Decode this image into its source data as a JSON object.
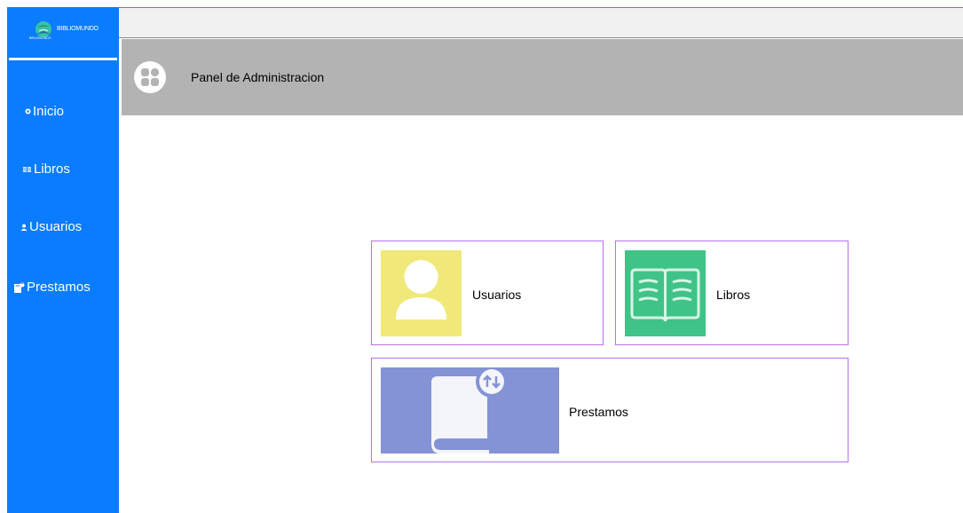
{
  "colors": {
    "sidebar": "#0a7cff",
    "header": "#b3b3b3",
    "card_border": "#b86ff0",
    "usuarios_tile": "#f0e97a",
    "libros_tile": "#3fc386",
    "prestamos_tile": "#8493d6"
  },
  "brand": {
    "name": "BIBLIOMUNDO",
    "sub": "BIBLIOMUNDO"
  },
  "sidebar": {
    "items": [
      {
        "label": "Inicio",
        "icon": "home-icon"
      },
      {
        "label": "Libros",
        "icon": "books-icon"
      },
      {
        "label": "Usuarios",
        "icon": "user-icon"
      },
      {
        "label": "Prestamos",
        "icon": "loan-icon"
      }
    ]
  },
  "header": {
    "title": "Panel de Administracion",
    "icon": "dashboard-grid-icon"
  },
  "cards": [
    {
      "label": "Usuarios",
      "icon": "user-avatar-icon"
    },
    {
      "label": "Libros",
      "icon": "open-book-icon"
    },
    {
      "label": "Prestamos",
      "icon": "book-transfer-icon"
    }
  ]
}
